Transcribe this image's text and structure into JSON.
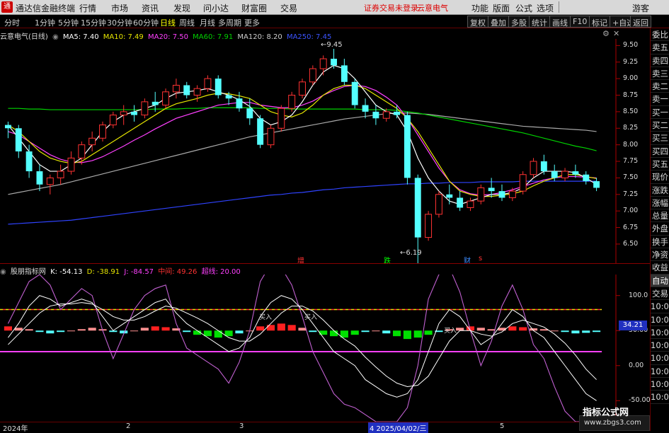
{
  "menubar": {
    "logo": "通",
    "app_title": "通达信金融终端",
    "menus": [
      "行情",
      "市场",
      "资讯",
      "发现",
      "问小达",
      "财富圈",
      "交易"
    ],
    "notice": "证券交易未登录",
    "stock_name_top": "云意电气",
    "right_menus": [
      "功能",
      "版面",
      "公式",
      "选项"
    ],
    "user": "游客"
  },
  "toolbar": {
    "timeframes": [
      "分时",
      "1分钟",
      "5分钟",
      "15分钟",
      "30分钟",
      "60分钟",
      "日线",
      "周线",
      "月线",
      "多周期",
      "更多"
    ],
    "active_timeframe": "日线",
    "buttons": [
      "复权",
      "叠加",
      "多股",
      "统计",
      "画线",
      "F10",
      "标记",
      "+自选",
      "返回"
    ]
  },
  "main_legend": {
    "stock": "云意电气(日线)",
    "ma5": "MA5: 7.40",
    "ma10": "MA10: 7.49",
    "ma20": "MA20: 7.50",
    "ma60": "MA60: 7.91",
    "ma120": "MA120: 8.20",
    "ma250": "MA250: 7.45"
  },
  "main_annotations": {
    "high": "9.45",
    "low": "6.19",
    "tag_zeng": "增",
    "tag_die": "跌",
    "tag_cai": "财",
    "tag_s": "s"
  },
  "price_axis": [
    "9.50",
    "9.25",
    "9.00",
    "8.75",
    "8.50",
    "8.25",
    "8.00",
    "7.75",
    "7.50",
    "7.25",
    "7.00",
    "6.75",
    "6.50"
  ],
  "indicator_legend": {
    "name": "股朋指标网",
    "k": "K: -54.13",
    "d": "D: -38.91",
    "j": "J: -84.57",
    "mid": "中间: 49.26",
    "line": "超线: 20.00"
  },
  "indicator_axis": [
    "100.0",
    "50.00",
    "0.00",
    "-50.00"
  ],
  "indicator_current": "34.21",
  "indicator_tags": [
    "买入",
    "买入",
    "买入"
  ],
  "date_axis": {
    "start": "2024年",
    "m2": "2",
    "m3": "3",
    "cursor": "4 2025/04/02/三",
    "m5": "5"
  },
  "side_panel": {
    "items": [
      "委比",
      "卖五",
      "卖四",
      "卖三",
      "卖二",
      "卖一",
      "买一",
      "买二",
      "买三",
      "买四",
      "买五",
      "现价",
      "涨跌",
      "涨幅",
      "总量",
      "外盘",
      "换手",
      "净资",
      "收益",
      "自动",
      "交易",
      "10:06",
      "10:06",
      "10:06",
      "10:06",
      "10:06",
      "10:06",
      "10:06",
      "10:07"
    ]
  },
  "watermark": {
    "title": "指标公式网",
    "url": "www.zbgs3.com"
  },
  "colors": {
    "up": "#ff3232",
    "down": "#54ffff",
    "ma5": "#ffffff",
    "ma10": "#e6e600",
    "ma20": "#ff40ff",
    "ma60": "#00d200",
    "ma120": "#aaaaaa",
    "ma250": "#2f43ff"
  },
  "chart_data": {
    "type": "candlestick",
    "title": "云意电气(日线)",
    "ylim": [
      6.2,
      9.6
    ],
    "candles": [
      [
        8.3,
        8.35,
        8.1,
        8.25
      ],
      [
        8.25,
        8.3,
        7.8,
        7.9
      ],
      [
        7.9,
        8.0,
        7.5,
        7.6
      ],
      [
        7.6,
        7.7,
        7.3,
        7.4
      ],
      [
        7.4,
        7.55,
        7.25,
        7.5
      ],
      [
        7.5,
        7.7,
        7.4,
        7.6
      ],
      [
        7.6,
        7.9,
        7.55,
        7.8
      ],
      [
        7.8,
        8.05,
        7.7,
        8.0
      ],
      [
        8.0,
        8.2,
        7.9,
        8.1
      ],
      [
        8.1,
        8.35,
        8.05,
        8.3
      ],
      [
        8.3,
        8.5,
        8.25,
        8.45
      ],
      [
        8.45,
        8.6,
        8.3,
        8.5
      ],
      [
        8.5,
        8.6,
        8.35,
        8.45
      ],
      [
        8.45,
        8.7,
        8.4,
        8.65
      ],
      [
        8.65,
        8.8,
        8.5,
        8.6
      ],
      [
        8.6,
        8.85,
        8.55,
        8.8
      ],
      [
        8.8,
        9.0,
        8.7,
        8.9
      ],
      [
        8.9,
        8.95,
        8.7,
        8.75
      ],
      [
        8.75,
        8.9,
        8.65,
        8.85
      ],
      [
        8.85,
        9.05,
        8.8,
        9.0
      ],
      [
        9.0,
        9.05,
        8.7,
        8.75
      ],
      [
        8.75,
        8.8,
        8.6,
        8.7
      ],
      [
        8.7,
        8.8,
        8.5,
        8.55
      ],
      [
        8.55,
        8.7,
        8.3,
        8.4
      ],
      [
        8.4,
        8.45,
        7.95,
        8.0
      ],
      [
        8.0,
        8.3,
        7.95,
        8.25
      ],
      [
        8.25,
        8.6,
        8.2,
        8.55
      ],
      [
        8.55,
        8.8,
        8.5,
        8.75
      ],
      [
        8.75,
        9.0,
        8.7,
        8.95
      ],
      [
        8.95,
        9.2,
        8.9,
        9.15
      ],
      [
        9.15,
        9.35,
        9.05,
        9.3
      ],
      [
        9.3,
        9.45,
        9.15,
        9.2
      ],
      [
        9.2,
        9.3,
        8.9,
        8.95
      ],
      [
        8.95,
        9.0,
        8.55,
        8.6
      ],
      [
        8.6,
        8.7,
        8.4,
        8.5
      ],
      [
        8.5,
        8.6,
        8.3,
        8.4
      ],
      [
        8.4,
        8.55,
        8.35,
        8.5
      ],
      [
        8.5,
        8.6,
        8.4,
        8.45
      ],
      [
        8.45,
        8.5,
        7.4,
        7.5
      ],
      [
        7.5,
        7.55,
        6.19,
        6.6
      ],
      [
        6.6,
        7.0,
        6.55,
        6.95
      ],
      [
        6.95,
        7.3,
        6.9,
        7.25
      ],
      [
        7.25,
        7.4,
        7.1,
        7.2
      ],
      [
        7.2,
        7.3,
        7.0,
        7.05
      ],
      [
        7.05,
        7.2,
        7.0,
        7.15
      ],
      [
        7.15,
        7.4,
        7.1,
        7.35
      ],
      [
        7.35,
        7.5,
        7.2,
        7.3
      ],
      [
        7.3,
        7.4,
        7.15,
        7.2
      ],
      [
        7.2,
        7.35,
        7.15,
        7.3
      ],
      [
        7.3,
        7.6,
        7.25,
        7.55
      ],
      [
        7.55,
        7.8,
        7.5,
        7.75
      ],
      [
        7.75,
        7.85,
        7.55,
        7.6
      ],
      [
        7.6,
        7.7,
        7.45,
        7.5
      ],
      [
        7.5,
        7.65,
        7.45,
        7.6
      ],
      [
        7.6,
        7.7,
        7.5,
        7.55
      ],
      [
        7.55,
        7.6,
        7.4,
        7.45
      ],
      [
        7.45,
        7.5,
        7.3,
        7.35
      ]
    ],
    "ma5": [
      8.3,
      8.1,
      7.9,
      7.7,
      7.6,
      7.6,
      7.7,
      7.8,
      8.0,
      8.2,
      8.35,
      8.45,
      8.5,
      8.55,
      8.6,
      8.7,
      8.78,
      8.8,
      8.82,
      8.85,
      8.8,
      8.75,
      8.68,
      8.58,
      8.4,
      8.3,
      8.35,
      8.45,
      8.65,
      8.9,
      9.1,
      9.2,
      9.15,
      9.0,
      8.8,
      8.6,
      8.5,
      8.45,
      8.2,
      7.8,
      7.5,
      7.3,
      7.15,
      7.1,
      7.15,
      7.2,
      7.25,
      7.25,
      7.28,
      7.35,
      7.5,
      7.6,
      7.6,
      7.6,
      7.58,
      7.5,
      7.4
    ],
    "ma10": [
      8.3,
      8.2,
      8.05,
      7.9,
      7.8,
      7.75,
      7.72,
      7.75,
      7.85,
      7.95,
      8.05,
      8.15,
      8.25,
      8.35,
      8.45,
      8.55,
      8.62,
      8.66,
      8.7,
      8.75,
      8.78,
      8.77,
      8.74,
      8.7,
      8.6,
      8.5,
      8.45,
      8.42,
      8.48,
      8.6,
      8.75,
      8.85,
      8.9,
      8.9,
      8.85,
      8.75,
      8.65,
      8.55,
      8.4,
      8.2,
      7.95,
      7.7,
      7.45,
      7.3,
      7.25,
      7.22,
      7.22,
      7.24,
      7.26,
      7.3,
      7.38,
      7.45,
      7.5,
      7.55,
      7.55,
      7.52,
      7.49
    ],
    "ma20": [
      8.2,
      8.15,
      8.05,
      7.95,
      7.85,
      7.78,
      7.74,
      7.73,
      7.76,
      7.82,
      7.9,
      7.98,
      8.07,
      8.15,
      8.24,
      8.32,
      8.4,
      8.45,
      8.5,
      8.55,
      8.6,
      8.62,
      8.64,
      8.64,
      8.6,
      8.58,
      8.56,
      8.56,
      8.6,
      8.66,
      8.75,
      8.82,
      8.88,
      8.9,
      8.88,
      8.82,
      8.72,
      8.6,
      8.4,
      8.15,
      7.9,
      7.65,
      7.45,
      7.32,
      7.26,
      7.24,
      7.25,
      7.28,
      7.32,
      7.37,
      7.42,
      7.47,
      7.5,
      7.52,
      7.52,
      7.51,
      7.5
    ],
    "ma60": [
      8.55,
      8.55,
      8.54,
      8.54,
      8.53,
      8.53,
      8.53,
      8.53,
      8.53,
      8.53,
      8.53,
      8.53,
      8.53,
      8.53,
      8.54,
      8.54,
      8.54,
      8.55,
      8.55,
      8.56,
      8.56,
      8.56,
      8.56,
      8.56,
      8.55,
      8.55,
      8.55,
      8.54,
      8.54,
      8.54,
      8.54,
      8.54,
      8.54,
      8.54,
      8.53,
      8.53,
      8.53,
      8.52,
      8.5,
      8.48,
      8.45,
      8.42,
      8.39,
      8.36,
      8.33,
      8.3,
      8.27,
      8.24,
      8.21,
      8.18,
      8.14,
      8.1,
      8.06,
      8.02,
      7.98,
      7.95,
      7.91
    ],
    "ma120": [
      7.25,
      7.28,
      7.31,
      7.34,
      7.37,
      7.4,
      7.44,
      7.48,
      7.52,
      7.56,
      7.6,
      7.64,
      7.68,
      7.72,
      7.76,
      7.8,
      7.84,
      7.88,
      7.92,
      7.96,
      8.0,
      8.04,
      8.08,
      8.12,
      8.15,
      8.18,
      8.21,
      8.24,
      8.27,
      8.3,
      8.33,
      8.36,
      8.39,
      8.41,
      8.43,
      8.45,
      8.47,
      8.48,
      8.48,
      8.47,
      8.46,
      8.44,
      8.42,
      8.4,
      8.38,
      8.36,
      8.34,
      8.32,
      8.3,
      8.28,
      8.27,
      8.26,
      8.25,
      8.24,
      8.23,
      8.22,
      8.2
    ],
    "ma250": [
      6.8,
      6.81,
      6.82,
      6.83,
      6.84,
      6.85,
      6.86,
      6.88,
      6.9,
      6.92,
      6.94,
      6.96,
      6.98,
      7.0,
      7.02,
      7.04,
      7.06,
      7.08,
      7.1,
      7.12,
      7.14,
      7.16,
      7.18,
      7.2,
      7.22,
      7.24,
      7.25,
      7.27,
      7.28,
      7.3,
      7.32,
      7.33,
      7.35,
      7.36,
      7.37,
      7.38,
      7.39,
      7.4,
      7.41,
      7.41,
      7.42,
      7.42,
      7.43,
      7.43,
      7.43,
      7.44,
      7.44,
      7.44,
      7.44,
      7.45,
      7.45,
      7.45,
      7.45,
      7.45,
      7.45,
      7.45,
      7.45
    ],
    "indicator": {
      "ylim": [
        -80,
        130
      ],
      "upper_line": 80,
      "lower_line": 20,
      "k": [
        40,
        60,
        85,
        100,
        95,
        85,
        90,
        95,
        90,
        70,
        50,
        60,
        70,
        80,
        90,
        95,
        75,
        60,
        50,
        40,
        30,
        20,
        25,
        40,
        70,
        90,
        100,
        95,
        80,
        60,
        40,
        20,
        10,
        0,
        -20,
        -30,
        -40,
        -45,
        -40,
        -20,
        20,
        60,
        80,
        70,
        50,
        30,
        40,
        60,
        80,
        70,
        50,
        40,
        20,
        0,
        -20,
        -40,
        -50
      ],
      "d": [
        30,
        45,
        60,
        75,
        85,
        88,
        88,
        90,
        88,
        80,
        70,
        65,
        65,
        70,
        78,
        85,
        82,
        75,
        68,
        60,
        50,
        40,
        35,
        35,
        45,
        60,
        75,
        85,
        85,
        78,
        65,
        50,
        38,
        28,
        12,
        -2,
        -15,
        -25,
        -30,
        -28,
        -15,
        10,
        35,
        50,
        50,
        45,
        42,
        48,
        60,
        65,
        60,
        55,
        45,
        32,
        15,
        -5,
        -20
      ],
      "j": [
        60,
        90,
        120,
        130,
        115,
        80,
        95,
        110,
        100,
        50,
        10,
        45,
        80,
        100,
        110,
        115,
        60,
        25,
        15,
        5,
        -5,
        -25,
        5,
        50,
        120,
        145,
        140,
        115,
        70,
        20,
        -10,
        -40,
        -55,
        -60,
        -70,
        -80,
        -80,
        -80,
        -60,
        0,
        95,
        130,
        140,
        105,
        50,
        0,
        35,
        85,
        115,
        80,
        30,
        10,
        -30,
        -65,
        -80,
        -80,
        -80
      ],
      "hist": [
        15,
        10,
        5,
        -5,
        -10,
        -5,
        0,
        5,
        10,
        5,
        -5,
        -10,
        0,
        10,
        15,
        12,
        8,
        -5,
        -15,
        -20,
        -25,
        -20,
        -10,
        0,
        15,
        20,
        25,
        20,
        10,
        -5,
        -15,
        -20,
        -25,
        -15,
        -5,
        0,
        -10,
        -20,
        -30,
        -25,
        -15,
        -5,
        5,
        10,
        15,
        10,
        5,
        10,
        15,
        12,
        8,
        5,
        0,
        -5,
        -10,
        -8,
        -5
      ]
    }
  }
}
